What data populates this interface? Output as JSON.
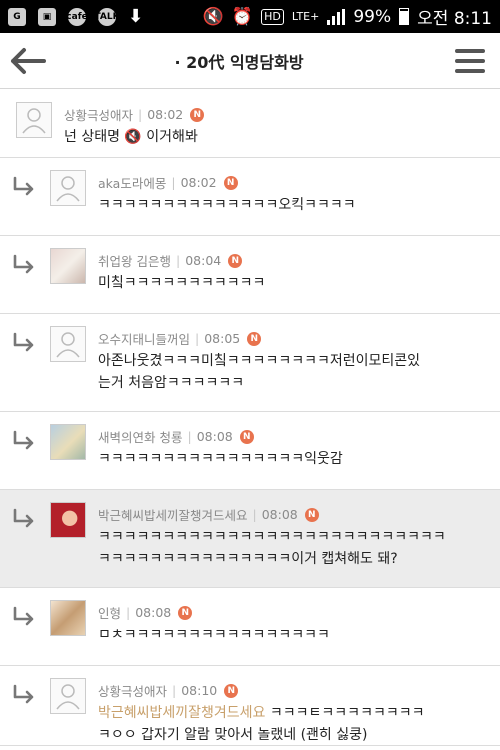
{
  "status_bar": {
    "icons": [
      "g-icon",
      "gallery-icon",
      "cafe-icon",
      "talk-icon",
      "download-icon"
    ],
    "battery": "99%",
    "clock": "오전 8:11",
    "hd": "HD",
    "network": "LTE+"
  },
  "header": {
    "title": "· 20代 익명담화방"
  },
  "comments": [
    {
      "author": "상황극성애자",
      "time": "08:02",
      "badge": "N",
      "text": "넌 상태명 🔇 이거해봐",
      "reply": false,
      "avatar": "default"
    },
    {
      "author": "aka도라에몽",
      "time": "08:02",
      "badge": "N",
      "text": "ㅋㅋㅋㅋㅋㅋㅋㅋㅋㅋㅋㅋㅋㅋ오킥ㅋㅋㅋㅋ",
      "reply": true,
      "avatar": "default"
    },
    {
      "author": "취업왕 김은행",
      "time": "08:04",
      "badge": "N",
      "text": "미칰ㅋㅋㅋㅋㅋㅋㅋㅋㅋㅋㅋ",
      "reply": true,
      "avatar": "photo-person"
    },
    {
      "author": "오수지태니들꺼임",
      "time": "08:05",
      "badge": "N",
      "text": "아존나웃겼ㅋㅋㅋ미칰ㅋㅋㅋㅋㅋㅋㅋㅋ저런이모티콘있\n는거 처음암ㅋㅋㅋㅋㅋㅋ",
      "reply": true,
      "avatar": "default"
    },
    {
      "author": "새벽의연화 청룡",
      "time": "08:08",
      "badge": "N",
      "text": "ㅋㅋㅋㅋㅋㅋㅋㅋㅋㅋㅋㅋㅋㅋㅋㅋ익웃감",
      "reply": true,
      "avatar": "photo-art"
    },
    {
      "author": "박근혜씨밥세끼잘챙겨드세요",
      "time": "08:08",
      "badge": "N",
      "text": "ㅋㅋㅋㅋㅋㅋㅋㅋㅋㅋㅋㅋㅋㅋㅋㅋㅋㅋㅋㅋㅋㅋㅋㅋㅋㅋㅋ\nㅋㅋㅋㅋㅋㅋㅋㅋㅋㅋㅋㅋㅋㅋㅋ이거 캡쳐해도 돼?",
      "reply": true,
      "avatar": "photo-red",
      "highlight": true
    },
    {
      "author": "인형",
      "time": "08:08",
      "badge": "N",
      "text": "ㅁㅊㅋㅋㅋㅋㅋㅋㅋㅋㅋㅋㅋㅋㅋㅋㅋㅋ",
      "reply": true,
      "avatar": "photo-dolls"
    },
    {
      "author": "상황극성애자",
      "time": "08:10",
      "badge": "N",
      "mention": "박근혜씨밥세끼잘챙겨드세요",
      "text": " ㅋㅋㅋㅌㅋㅋㅋㅋㅋㅋㅋㅋ\nㅋㅇㅇ 갑자기 알람 맞아서 놀랬네 (괜히 싫쿵)",
      "reply": true,
      "avatar": "default"
    }
  ]
}
